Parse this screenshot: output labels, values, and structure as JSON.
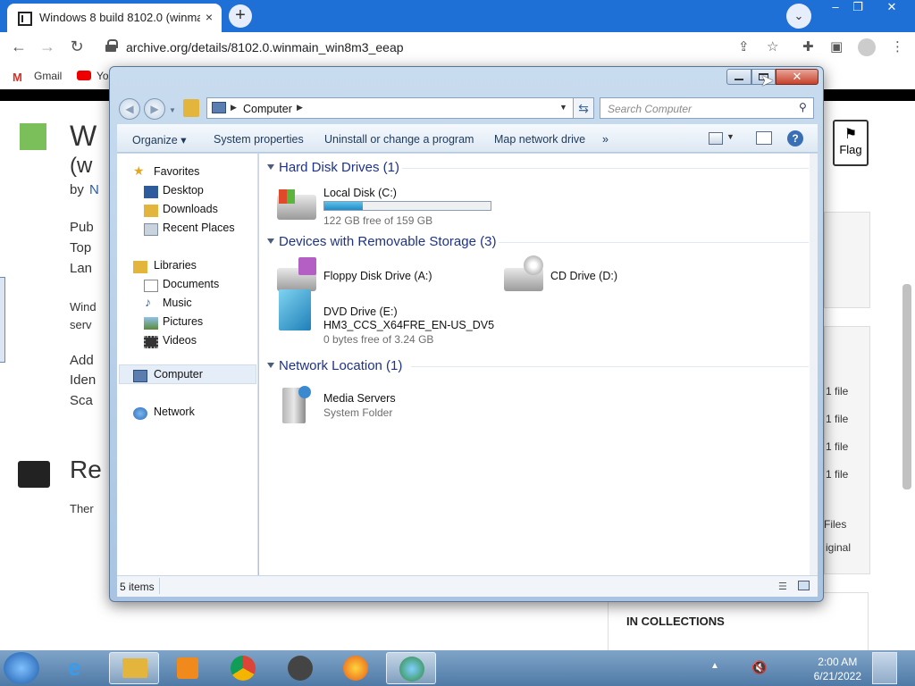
{
  "browser": {
    "tab_title": "Windows 8 build 8102.0 (winmain",
    "tab_close": "×",
    "newtab": "+",
    "tabsearch": "⌄",
    "url": "archive.org/details/8102.0.winmain_win8m3_eeap",
    "nav": {
      "back": "←",
      "forward": "→",
      "reload": "↻"
    },
    "bookmarks": [
      "Gmail",
      "Yo"
    ],
    "win_controls": {
      "min": "–",
      "max": "❐",
      "close": "✕"
    }
  },
  "page_behind": {
    "title_partial": "W",
    "title_line2": "(w",
    "by": "by",
    "by_link": "N",
    "meta_labels": [
      "Pub",
      "Top",
      "Lan"
    ],
    "desc_lines": [
      "Wind",
      "serv"
    ],
    "meta2": [
      "Add",
      "Iden",
      "Sca"
    ],
    "reviews_head": "Re",
    "reviews_text": "Ther",
    "flag": "Flag",
    "files": [
      "1 file",
      "1 file",
      "1 file",
      "1 file"
    ],
    "files_label": "Files",
    "original": "iginal",
    "collections": "IN COLLECTIONS"
  },
  "explorer": {
    "address_path": "Computer",
    "search_placeholder": "Search Computer",
    "commands": [
      "Organize",
      "System properties",
      "Uninstall or change a program",
      "Map network drive",
      "»"
    ],
    "nav": {
      "favorites": "Favorites",
      "fav_items": [
        "Desktop",
        "Downloads",
        "Recent Places"
      ],
      "libraries": "Libraries",
      "lib_items": [
        "Documents",
        "Music",
        "Pictures",
        "Videos"
      ],
      "computer": "Computer",
      "network": "Network"
    },
    "groups": {
      "hdd": "Hard Disk Drives (1)",
      "removable": "Devices with Removable Storage (3)",
      "network": "Network Location (1)"
    },
    "items": {
      "local_disk": {
        "name": "Local Disk (C:)",
        "free": "122 GB free of 159 GB",
        "used_fraction": 0.23
      },
      "floppy": {
        "name": "Floppy Disk Drive (A:)"
      },
      "cd": {
        "name": "CD Drive (D:)"
      },
      "dvd": {
        "name": "DVD Drive (E:)",
        "label": "HM3_CCS_X64FRE_EN-US_DV5",
        "free": "0 bytes free of 3.24 GB"
      },
      "media": {
        "name": "Media Servers",
        "type": "System Folder"
      }
    },
    "status": "5 items"
  },
  "taskbar": {
    "time": "2:00 AM",
    "date": "6/21/2022"
  }
}
